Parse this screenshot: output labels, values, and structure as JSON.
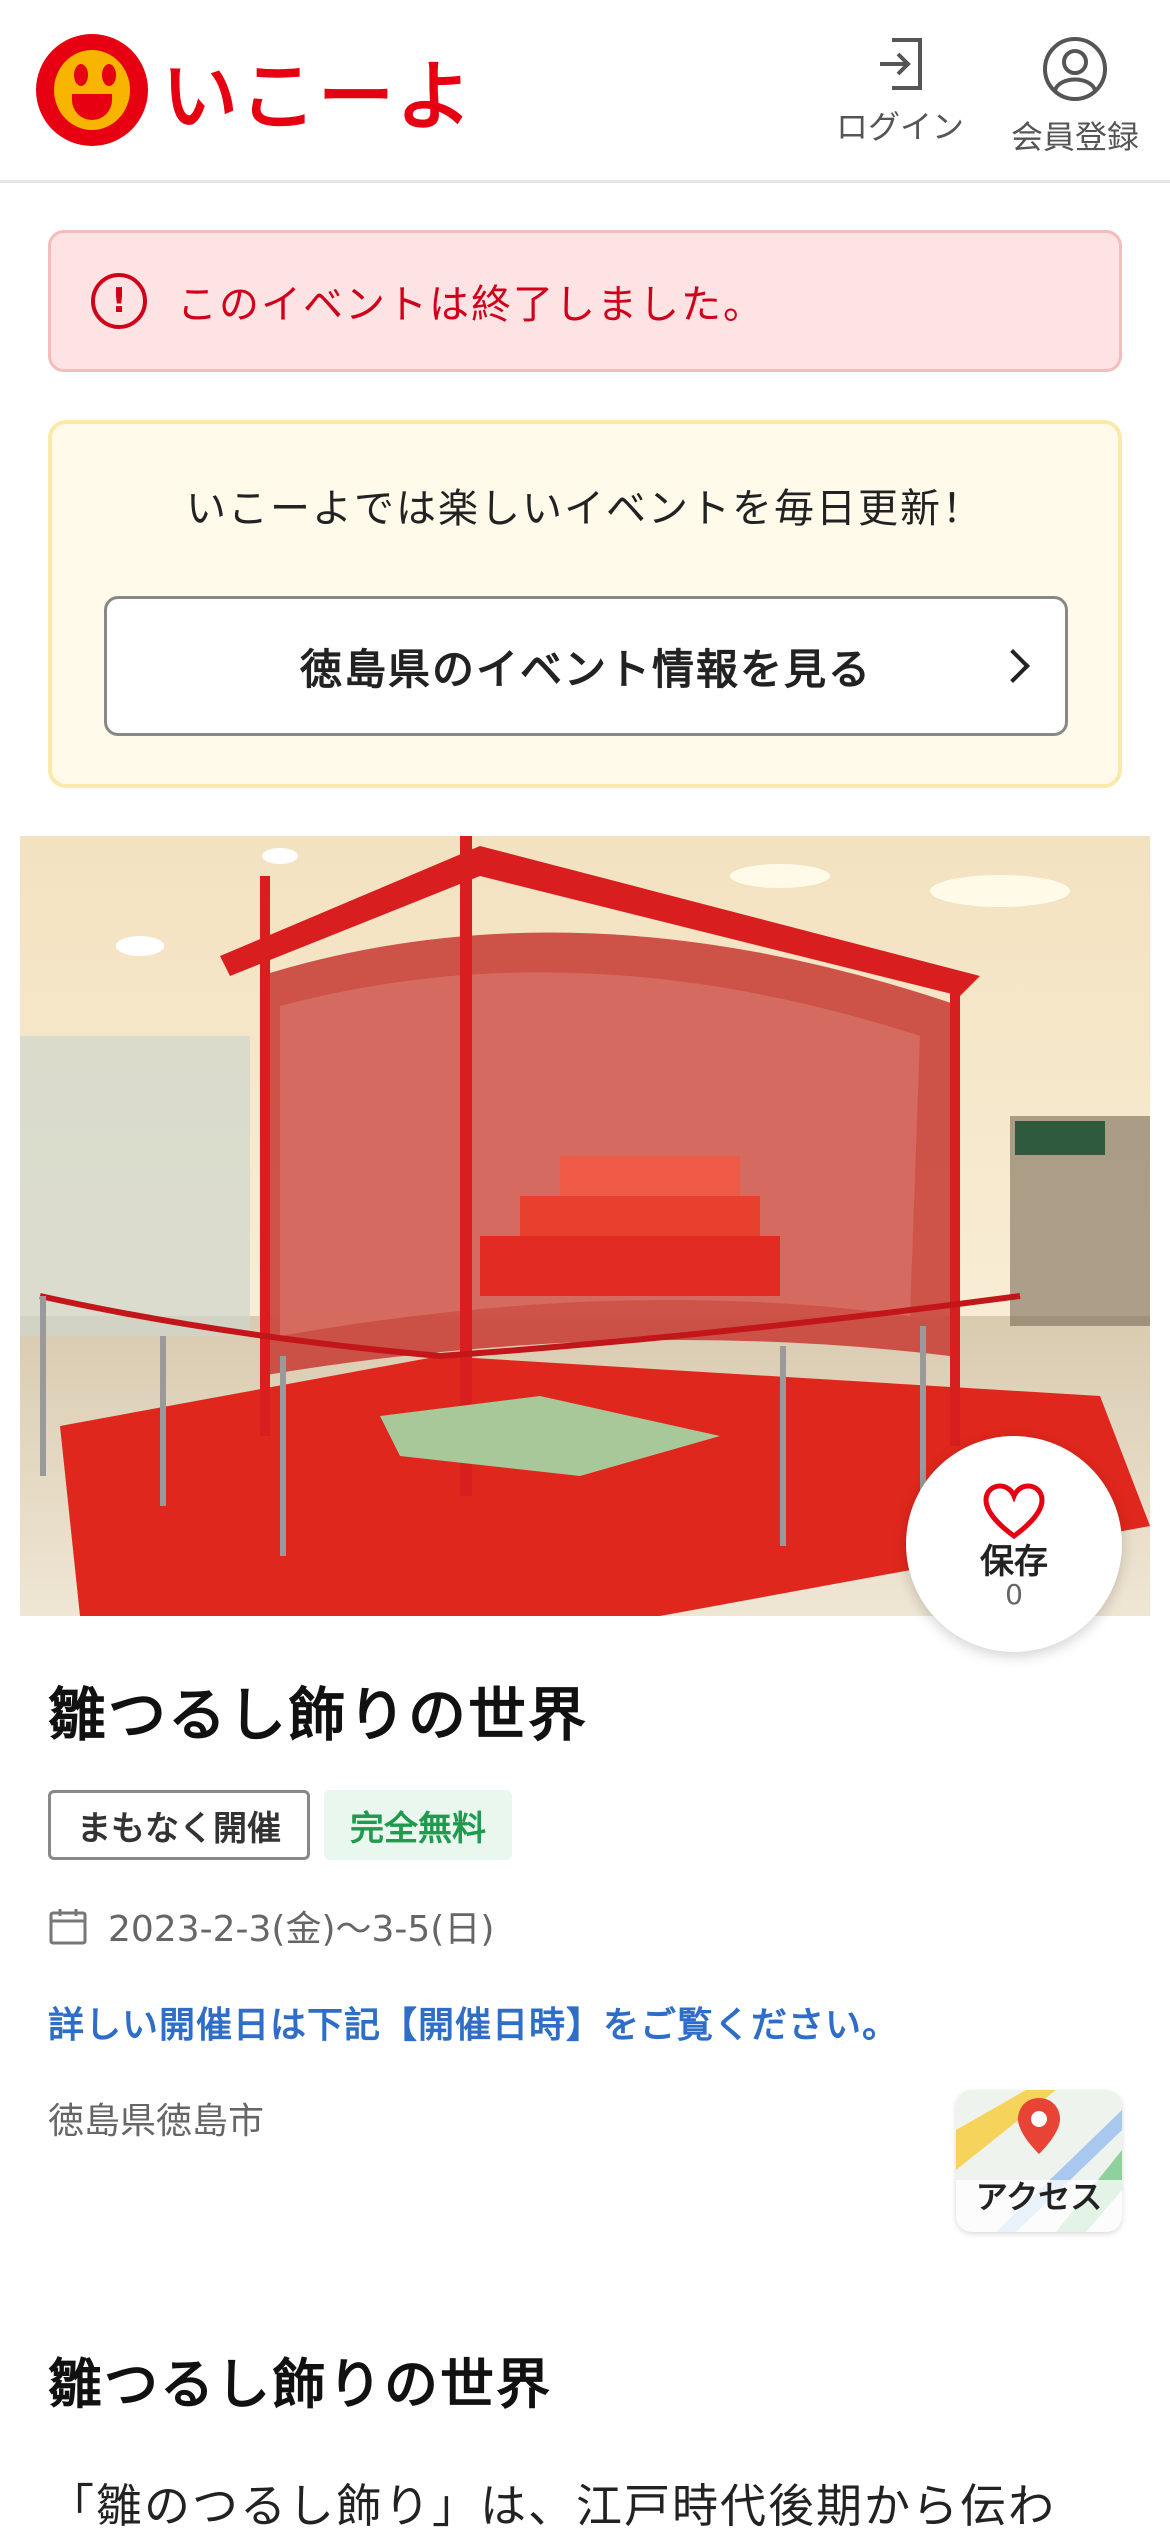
{
  "header": {
    "logo_text": "いこーよ",
    "login_label": "ログイン",
    "register_label": "会員登録"
  },
  "alert": {
    "icon": "exclamation-circle-icon",
    "text": "このイベントは終了しました。"
  },
  "promo": {
    "text": "いこーよでは楽しいイベントを毎日更新！",
    "button_label": "徳島県のイベント情報を見る"
  },
  "save": {
    "label": "保存",
    "count": "0"
  },
  "event": {
    "title": "雛つるし飾りの世界",
    "tags": [
      "まもなく開催",
      "完全無料"
    ],
    "date": "2023-2-3(金)〜3-5(日)",
    "detail_link": "詳しい開催日は下記【開催日時】をご覧ください。",
    "location": "徳島県徳島市",
    "access_label": "アクセス"
  },
  "section": {
    "title": "雛つるし飾りの世界",
    "body": "「雛のつるし飾り」は、江戸時代後期から伝わ"
  },
  "colors": {
    "brand_red": "#e60012",
    "brand_yellow": "#f7b500",
    "alert_text": "#d0021b",
    "link_blue": "#2f6ec8",
    "free_green": "#1f9a4f"
  }
}
